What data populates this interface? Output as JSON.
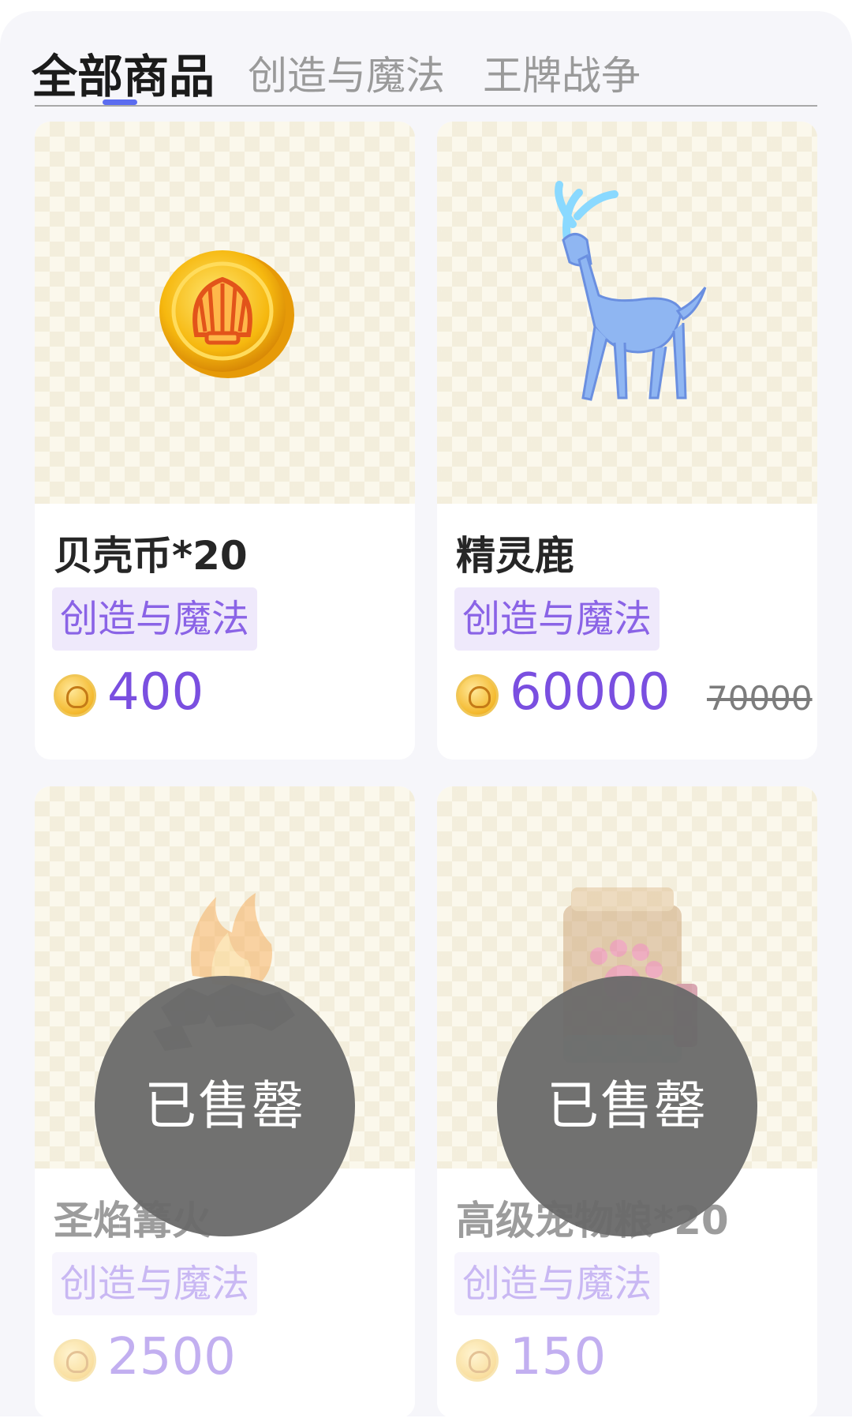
{
  "tabs": [
    {
      "label": "全部商品",
      "active": true
    },
    {
      "label": "创造与魔法",
      "active": false
    },
    {
      "label": "王牌战争",
      "active": false
    }
  ],
  "colors": {
    "accent": "#5b6cf0",
    "price": "#7a4fe0",
    "tag_bg": "#efe9fb",
    "tag_text": "#8a63e6"
  },
  "products": [
    {
      "name": "贝壳币*20",
      "tag": "创造与魔法",
      "price": "400",
      "old_price": "",
      "sold_out": false,
      "icon": "shell-coin-icon"
    },
    {
      "name": "精灵鹿",
      "tag": "创造与魔法",
      "price": "60000",
      "old_price": "70000",
      "sold_out": false,
      "icon": "spirit-deer-icon"
    },
    {
      "name": "圣焰篝火",
      "tag": "创造与魔法",
      "price": "2500",
      "old_price": "",
      "sold_out": true,
      "sold_label": "已售罄",
      "icon": "bonfire-icon"
    },
    {
      "name": "高级宠物粮*20",
      "tag": "创造与魔法",
      "price": "150",
      "old_price": "",
      "sold_out": true,
      "sold_label": "已售罄",
      "icon": "pet-food-bag-icon"
    }
  ]
}
